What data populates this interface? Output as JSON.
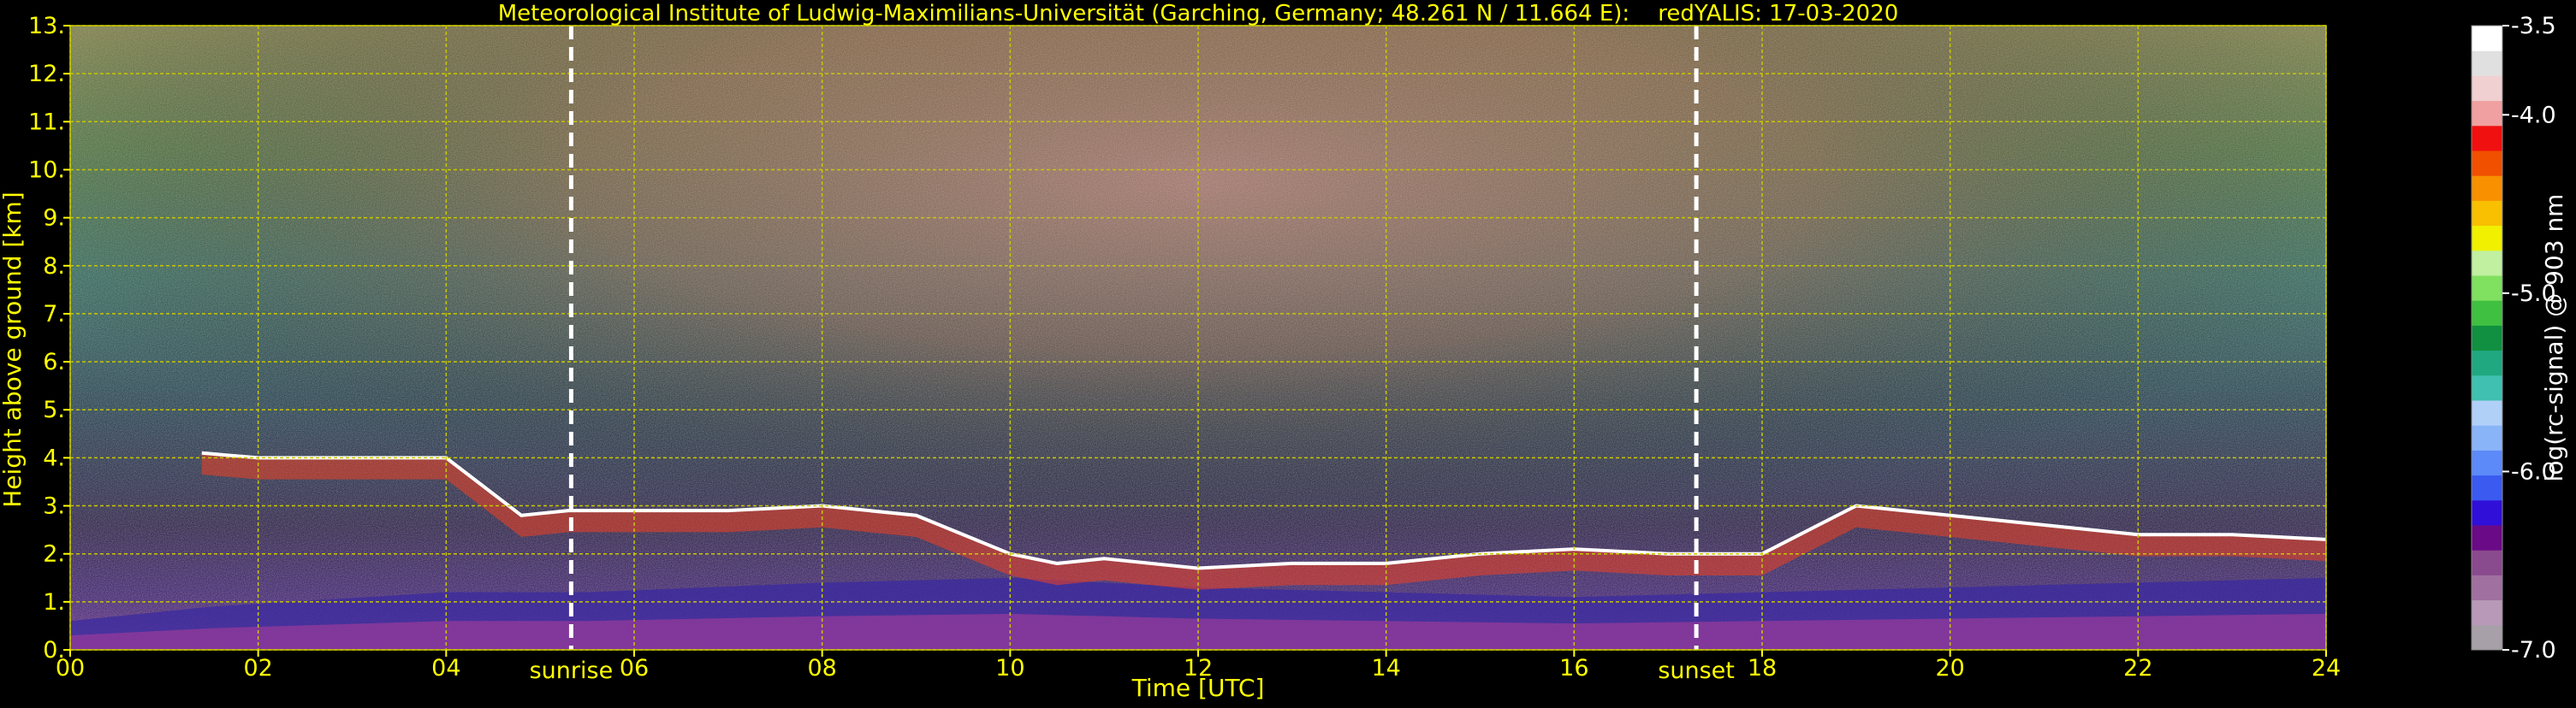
{
  "chart_data": {
    "type": "heatmap",
    "title": "Meteorological Institute of Ludwig-Maximilians-Universität (Garching, Germany; 48.261 N / 11.664 E):    redYALIS: 17-03-2020",
    "xlabel": "Time [UTC]",
    "ylabel": "Height above ground [km]",
    "xlim": [
      0,
      24
    ],
    "ylim": [
      0,
      13
    ],
    "x_ticks": [
      "00",
      "02",
      "04",
      "06",
      "08",
      "10",
      "12",
      "14",
      "16",
      "18",
      "20",
      "22",
      "24"
    ],
    "y_ticks": [
      "0.",
      "1.",
      "2.",
      "3.",
      "4.",
      "5.",
      "6.",
      "7.",
      "8.",
      "9.",
      "10.",
      "11.",
      "12.",
      "13."
    ],
    "grid": true,
    "colorbar": {
      "label": "log(rc-signal) @ 903 nm",
      "range": [
        -7.0,
        -3.5
      ],
      "ticks": [
        "-3.5",
        "-4.0",
        "-5.0",
        "-6.0",
        "-7.0"
      ],
      "colors": [
        "#a8a0a8",
        "#b89ab8",
        "#a070a0",
        "#8a4a8e",
        "#6a0a86",
        "#3010d8",
        "#3a5af0",
        "#5c8af8",
        "#8ab4f8",
        "#b0d0f8",
        "#40c0b0",
        "#20a880",
        "#109040",
        "#40c040",
        "#80e060",
        "#c0f0a0",
        "#f0f000",
        "#f8c000",
        "#f89000",
        "#f05000",
        "#f01010",
        "#f0a0a0",
        "#f0d0d0",
        "#e0e0e0",
        "#ffffff"
      ]
    },
    "annotations": [
      {
        "text": "sunrise",
        "x": 5.33
      },
      {
        "text": "sunset",
        "x": 17.3
      }
    ],
    "layers": [
      {
        "name": "boundary",
        "x": [
          0,
          1.5,
          4,
          5.5,
          8,
          10,
          12,
          14,
          16,
          18,
          20,
          22,
          24
        ],
        "y": [
          0.6,
          0.9,
          1.2,
          1.2,
          1.4,
          1.5,
          1.3,
          1.2,
          1.1,
          1.2,
          1.3,
          1.4,
          1.5
        ]
      },
      {
        "name": "cloud-layer",
        "x": [
          1.4,
          2,
          3,
          4,
          4.8,
          5.3,
          6,
          7,
          8,
          9,
          10,
          10.5,
          11,
          12,
          13,
          14,
          15,
          16,
          17,
          18,
          19,
          20,
          21,
          22,
          23,
          24
        ],
        "y": [
          4.1,
          4.0,
          4.0,
          4.0,
          2.8,
          2.9,
          2.9,
          2.9,
          3.0,
          2.8,
          2.0,
          1.8,
          1.9,
          1.7,
          1.8,
          1.8,
          2.0,
          2.1,
          2.0,
          2.0,
          3.0,
          2.8,
          2.6,
          2.4,
          2.4,
          2.3
        ]
      }
    ]
  }
}
